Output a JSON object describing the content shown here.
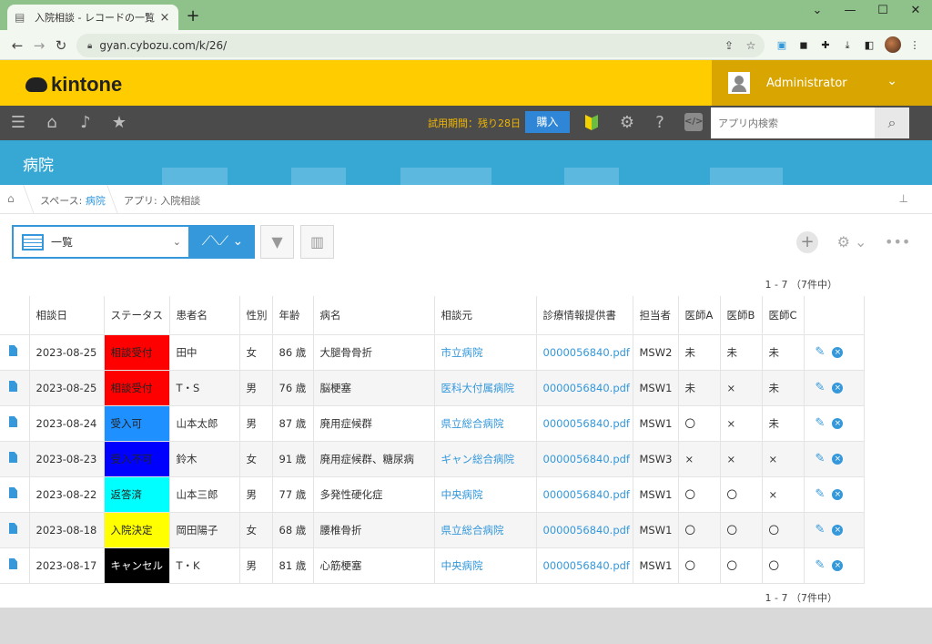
{
  "browser": {
    "tab_title": "入院相談 - レコードの一覧",
    "tab_close": "×",
    "new_tab": "+",
    "url": "gyan.cybozu.com/k/26/",
    "win_min": "—",
    "win_max": "☐",
    "win_close": "✕",
    "win_chevron": "⌄"
  },
  "header": {
    "logo_text": "kintone",
    "user_name": "Administrator",
    "trial_text": "試用期間：残り28日",
    "buy_label": "購入",
    "search_placeholder": "アプリ内検索",
    "code_icon_text": "</>"
  },
  "app": {
    "name": "病院"
  },
  "breadcrumb": {
    "space_prefix": "スペース: ",
    "space_name": "病院",
    "app_label": "アプリ: 入院相談"
  },
  "view": {
    "selected": "一覧",
    "paging_top": "1 - 7 （7件中）",
    "paging_bottom": "1 - 7 （7件中）"
  },
  "table": {
    "headers": [
      "相談日",
      "ステータス",
      "患者名",
      "性別",
      "年齢",
      "病名",
      "相談元",
      "診療情報提供書",
      "担当者",
      "医師A",
      "医師B",
      "医師C"
    ],
    "rows": [
      {
        "date": "2023-08-25",
        "status": "相談受付",
        "status_bg": "#ff0000",
        "status_fg": "#222222",
        "patient": "田中",
        "sex": "女",
        "age": "86 歳",
        "disease": "大腿骨骨折",
        "source": "市立病院",
        "file": "0000056840.pdf",
        "staff": "MSW2",
        "a": "未",
        "b": "未",
        "c": "未"
      },
      {
        "date": "2023-08-25",
        "status": "相談受付",
        "status_bg": "#ff0000",
        "status_fg": "#222222",
        "patient": "T・S",
        "sex": "男",
        "age": "76 歳",
        "disease": "脳梗塞",
        "source": "医科大付属病院",
        "file": "0000056840.pdf",
        "staff": "MSW1",
        "a": "未",
        "b": "×",
        "c": "未"
      },
      {
        "date": "2023-08-24",
        "status": "受入可",
        "status_bg": "#1e90ff",
        "status_fg": "#222222",
        "patient": "山本太郎",
        "sex": "男",
        "age": "87 歳",
        "disease": "廃用症候群",
        "source": "県立総合病院",
        "file": "0000056840.pdf",
        "staff": "MSW1",
        "a": "〇",
        "b": "×",
        "c": "未"
      },
      {
        "date": "2023-08-23",
        "status": "受入不可",
        "status_bg": "#0000ff",
        "status_fg": "#222222",
        "patient": "鈴木",
        "sex": "女",
        "age": "91 歳",
        "disease": "廃用症候群、糖尿病",
        "source": "ギャン総合病院",
        "file": "0000056840.pdf",
        "staff": "MSW3",
        "a": "×",
        "b": "×",
        "c": "×"
      },
      {
        "date": "2023-08-22",
        "status": "返答済",
        "status_bg": "#00ffff",
        "status_fg": "#222222",
        "patient": "山本三郎",
        "sex": "男",
        "age": "77 歳",
        "disease": "多発性硬化症",
        "source": "中央病院",
        "file": "0000056840.pdf",
        "staff": "MSW1",
        "a": "〇",
        "b": "〇",
        "c": "×"
      },
      {
        "date": "2023-08-18",
        "status": "入院決定",
        "status_bg": "#ffff00",
        "status_fg": "#222222",
        "patient": "岡田陽子",
        "sex": "女",
        "age": "68 歳",
        "disease": "腰椎骨折",
        "source": "県立総合病院",
        "file": "0000056840.pdf",
        "staff": "MSW1",
        "a": "〇",
        "b": "〇",
        "c": "〇"
      },
      {
        "date": "2023-08-17",
        "status": "キャンセル",
        "status_bg": "#000000",
        "status_fg": "#ffffff",
        "patient": "T・K",
        "sex": "男",
        "age": "81 歳",
        "disease": "心筋梗塞",
        "source": "中央病院",
        "file": "0000056840.pdf",
        "staff": "MSW1",
        "a": "〇",
        "b": "〇",
        "c": "〇"
      }
    ]
  },
  "icons": {
    "accent": "#3498db",
    "header_yellow": "#ffcc00",
    "appbar_blue": "#37a8d4"
  }
}
